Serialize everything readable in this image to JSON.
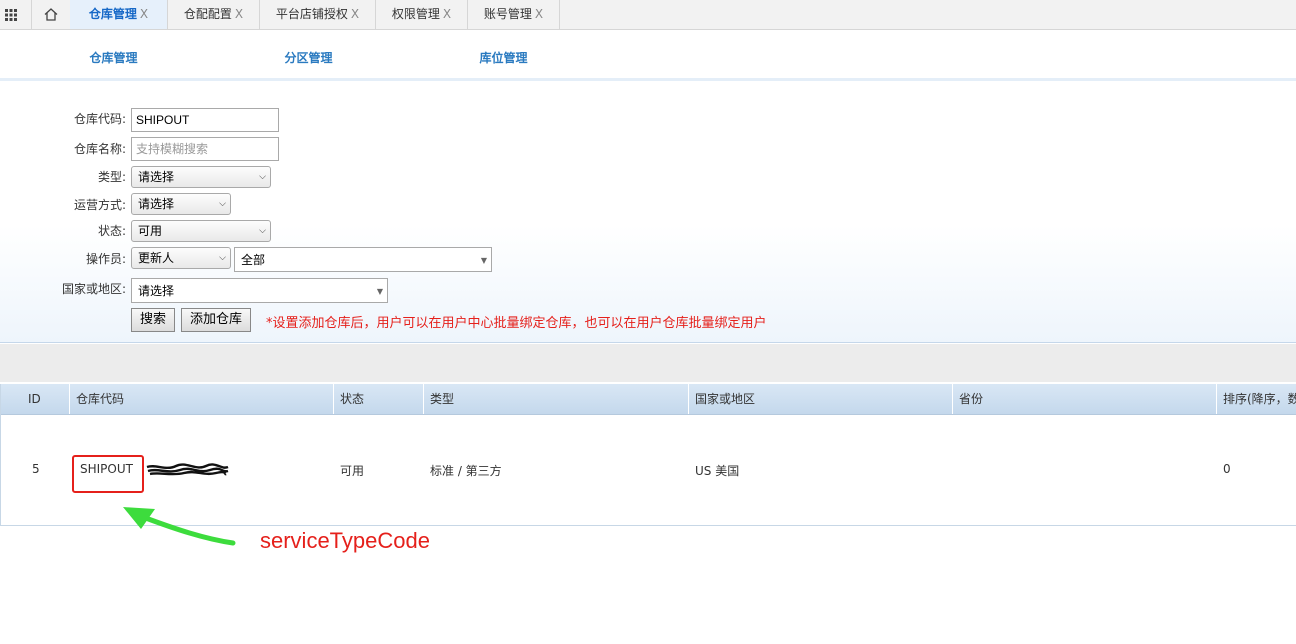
{
  "top_tabs": [
    {
      "label": "仓库管理",
      "active": true
    },
    {
      "label": "仓配配置"
    },
    {
      "label": "平台店铺授权"
    },
    {
      "label": "权限管理"
    },
    {
      "label": "账号管理"
    }
  ],
  "close_glyph": "X",
  "sub_tabs": [
    {
      "label": "仓库管理",
      "active": true
    },
    {
      "label": "分区管理"
    },
    {
      "label": "库位管理"
    }
  ],
  "form": {
    "warehouse_code_label": "仓库代码:",
    "warehouse_code_value": "SHIPOUT",
    "warehouse_name_label": "仓库名称:",
    "warehouse_name_placeholder": "支持模糊搜索",
    "type_label": "类型:",
    "type_value": "请选择",
    "operation_label": "运营方式:",
    "operation_value": "请选择",
    "status_label": "状态:",
    "status_value": "可用",
    "operator_label": "操作员:",
    "operator_value": "更新人",
    "operator_scope_value": "全部",
    "country_label": "国家或地区:",
    "country_value": "请选择",
    "search_button": "搜索",
    "add_button": "添加仓库",
    "notice": "*设置添加仓库后，用户可以在用户中心批量绑定仓库，也可以在用户仓库批量绑定用户"
  },
  "table": {
    "columns": [
      "ID",
      "仓库代码",
      "状态",
      "类型",
      "国家或地区",
      "省份",
      "排序(降序，数"
    ],
    "rows": [
      {
        "id": "5",
        "code": "SHIPOUT",
        "status": "可用",
        "type": "标准 / 第三方",
        "country": "US 美国",
        "province": "",
        "sort": "0"
      }
    ]
  },
  "annotation": {
    "text": "serviceTypeCode",
    "color": "#e5201b",
    "arrow_color": "#3ddc3d"
  }
}
